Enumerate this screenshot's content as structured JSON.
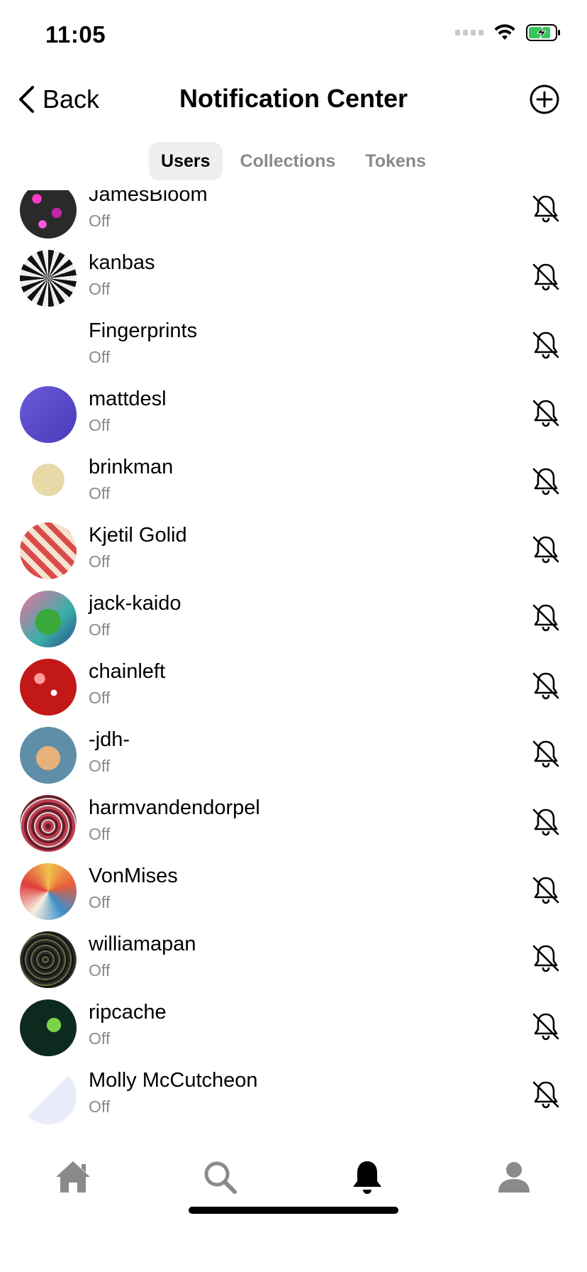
{
  "status_bar": {
    "time": "11:05"
  },
  "nav": {
    "back_label": "Back",
    "title": "Notification Center"
  },
  "tabs": [
    {
      "label": "Users",
      "active": true
    },
    {
      "label": "Collections",
      "active": false
    },
    {
      "label": "Tokens",
      "active": false
    }
  ],
  "users": [
    {
      "name": "JamesBloom",
      "status": "Off"
    },
    {
      "name": "kanbas",
      "status": "Off"
    },
    {
      "name": "Fingerprints",
      "status": "Off"
    },
    {
      "name": "mattdesl",
      "status": "Off"
    },
    {
      "name": "brinkman",
      "status": "Off"
    },
    {
      "name": "Kjetil Golid",
      "status": "Off"
    },
    {
      "name": "jack-kaido",
      "status": "Off"
    },
    {
      "name": "chainleft",
      "status": "Off"
    },
    {
      "name": "-jdh-",
      "status": "Off"
    },
    {
      "name": "harmvandendorpel",
      "status": "Off"
    },
    {
      "name": "VonMises",
      "status": "Off"
    },
    {
      "name": "williamapan",
      "status": "Off"
    },
    {
      "name": "ripcache",
      "status": "Off"
    },
    {
      "name": "Molly McCutcheon",
      "status": "Off"
    }
  ],
  "tabbar": {
    "items": [
      {
        "icon": "home-icon",
        "active": false
      },
      {
        "icon": "search-icon",
        "active": false
      },
      {
        "icon": "bell-icon",
        "active": true
      },
      {
        "icon": "profile-icon",
        "active": false
      }
    ]
  },
  "colors": {
    "inactive": "#8a8a8a",
    "active": "#000000",
    "tab_bg": "#efefef",
    "battery": "#34c759"
  }
}
